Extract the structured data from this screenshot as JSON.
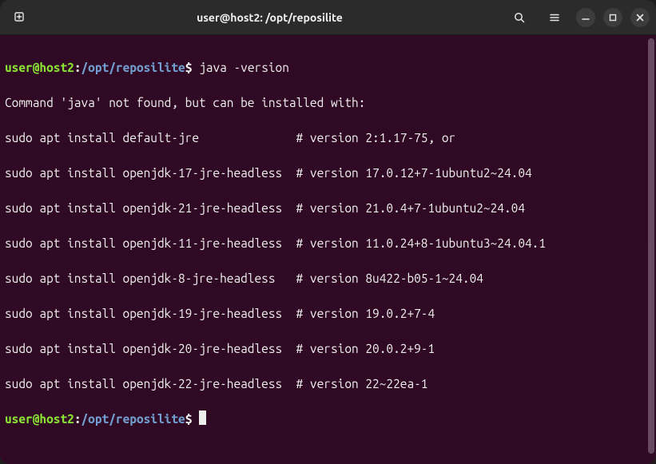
{
  "titlebar": {
    "title": "user@host2: /opt/reposilite"
  },
  "terminal": {
    "prompt_user": "user@host2",
    "prompt_sep": ":",
    "prompt_path": "/opt/reposilite",
    "prompt_end": "$",
    "command1": "java -version",
    "output": [
      "Command 'java' not found, but can be installed with:",
      "sudo apt install default-jre              # version 2:1.17-75, or",
      "sudo apt install openjdk-17-jre-headless  # version 17.0.12+7-1ubuntu2~24.04",
      "sudo apt install openjdk-21-jre-headless  # version 21.0.4+7-1ubuntu2~24.04",
      "sudo apt install openjdk-11-jre-headless  # version 11.0.24+8-1ubuntu3~24.04.1",
      "sudo apt install openjdk-8-jre-headless   # version 8u422-b05-1~24.04",
      "sudo apt install openjdk-19-jre-headless  # version 19.0.2+7-4",
      "sudo apt install openjdk-20-jre-headless  # version 20.0.2+9-1",
      "sudo apt install openjdk-22-jre-headless  # version 22~22ea-1"
    ]
  }
}
